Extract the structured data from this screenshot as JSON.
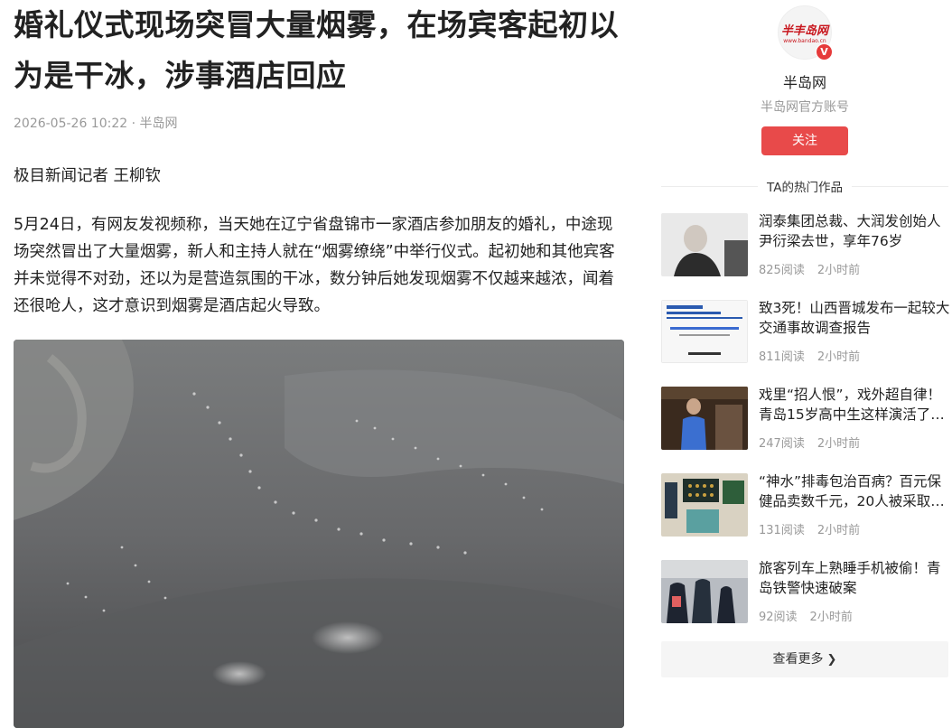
{
  "article": {
    "title": "婚礼仪式现场突冒大量烟雾，在场宾客起初以为是干冰，涉事酒店回应",
    "date": "2026-05-26 10:22",
    "separator": "·",
    "source": "半岛网",
    "author_line": "极目新闻记者 王柳钦",
    "paragraph": "5月24日，有网友发视频称，当天她在辽宁省盘锦市一家酒店参加朋友的婚礼，中途现场突然冒出了大量烟雾，新人和主持人就在“烟雾缭绕”中举行仪式。起初她和其他宾客并未觉得不对劲，还以为是营造氛围的干冰，数分钟后她发现烟雾不仅越来越浓，闻着还很呛人，这才意识到烟雾是酒店起火导致。"
  },
  "profile": {
    "logo_text": "半丰岛网",
    "logo_sub": "www.bandao.cn",
    "badge": "V",
    "name": "半岛网",
    "desc": "半岛网官方账号",
    "follow_label": "关注"
  },
  "hot": {
    "heading": "TA的热门作品",
    "items": [
      {
        "title": "润泰集团总裁、大润发创始人尹衍梁去世，享年76岁",
        "reads": "825阅读",
        "time": "2小时前"
      },
      {
        "title": "致3死！山西晋城发布一起较大交通事故调查报告",
        "reads": "811阅读",
        "time": "2小时前"
      },
      {
        "title": "戏里“招人恨”，戏外超自律！青岛15岁高中生这样演活了…",
        "reads": "247阅读",
        "time": "2小时前"
      },
      {
        "title": "“神水”排毒包治百病？百元保健品卖数千元，20人被采取…",
        "reads": "131阅读",
        "time": "2小时前"
      },
      {
        "title": "旅客列车上熟睡手机被偷！青岛铁警快速破案",
        "reads": "92阅读",
        "time": "2小时前"
      }
    ],
    "more_label": "查看更多"
  },
  "icons": {
    "verified": "verified-v-icon",
    "more": "chevron-right-icon"
  },
  "colors": {
    "accent": "#e84a4a",
    "muted": "#999999",
    "text": "#222222"
  }
}
